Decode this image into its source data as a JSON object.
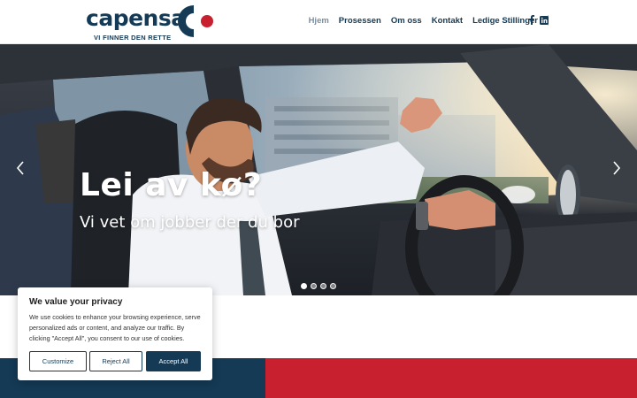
{
  "brand": {
    "name": "capensa",
    "tagline": "VI FINNER DEN RETTE",
    "navy": "#143a55",
    "red": "#c8202f"
  },
  "nav": {
    "items": [
      {
        "label": "Hjem",
        "active": true
      },
      {
        "label": "Prosessen",
        "active": false
      },
      {
        "label": "Om oss",
        "active": false
      },
      {
        "label": "Kontakt",
        "active": false
      },
      {
        "label": "Ledige Stillinger",
        "active": false
      }
    ],
    "social": [
      "facebook-icon",
      "linkedin-icon"
    ]
  },
  "hero": {
    "title": "Lei av kø?",
    "subtitle": "Vi vet om jobber der du bor",
    "slides": 4,
    "active_slide": 1,
    "icons": {
      "prev": "chevron-left-icon",
      "next": "chevron-right-icon"
    }
  },
  "cookie": {
    "title": "We value your privacy",
    "text": "We use cookies to enhance your browsing experience, serve personalized ads or content, and analyze our traffic. By clicking \"Accept All\", you consent to our use of cookies.",
    "customize": "Customize",
    "reject": "Reject All",
    "accept": "Accept All"
  }
}
